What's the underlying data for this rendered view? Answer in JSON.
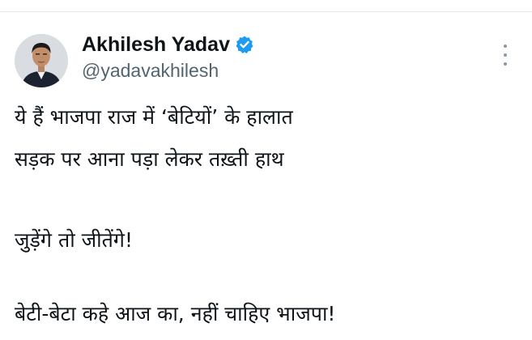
{
  "author": {
    "display_name": "Akhilesh Yadav",
    "handle": "@yadavakhilesh",
    "verified": true,
    "verified_color": "#1d9bf0"
  },
  "menu": {
    "icon": "more-vertical-icon"
  },
  "tweet": {
    "lines": [
      "ये हैं भाजपा राज में ‘बेटियों’ के हालात",
      "सड़क पर आना पड़ा लेकर तख़्ती हाथ",
      "जुड़ेंगे तो जीतेंगे!",
      "बेटी-बेटा कहे आज का, नहीं चाहिए भाजपा!"
    ]
  },
  "colors": {
    "text": "#0f1419",
    "secondary_text": "#536471",
    "divider": "#e6e8ea",
    "accent": "#1d9bf0"
  }
}
